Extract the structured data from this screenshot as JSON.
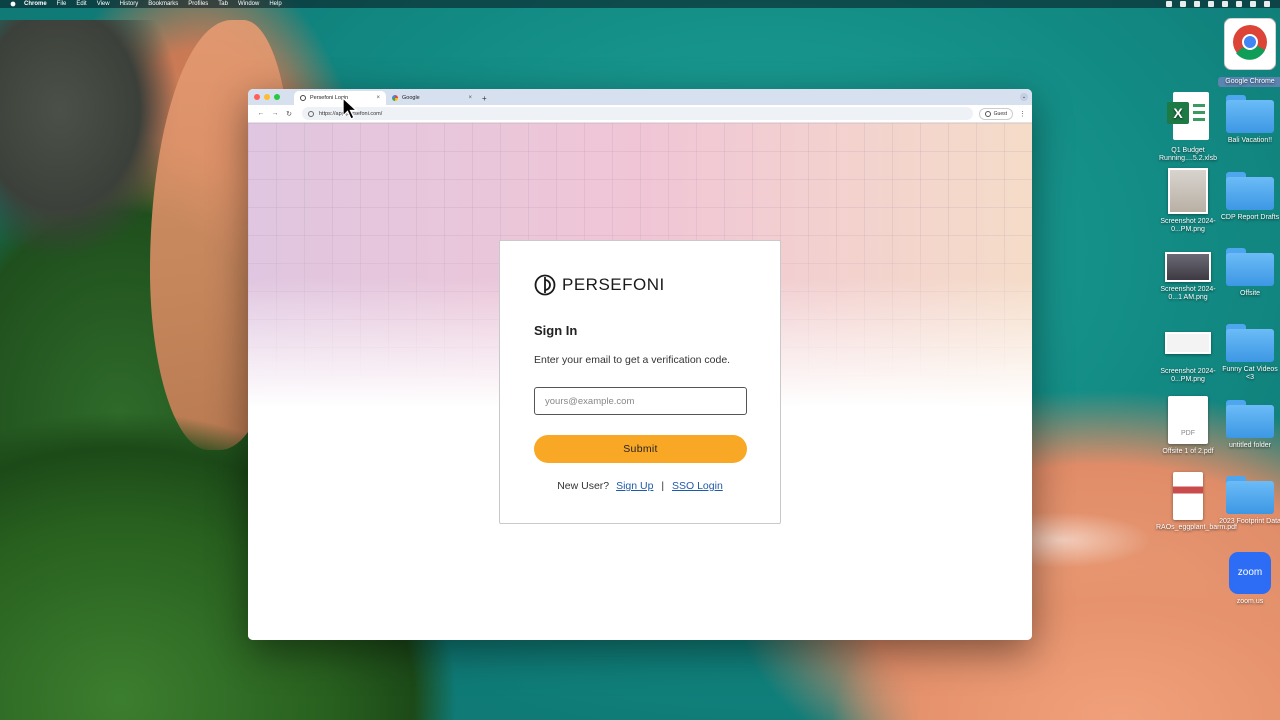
{
  "menubar": {
    "app": "Chrome",
    "items": [
      "File",
      "Edit",
      "View",
      "History",
      "Bookmarks",
      "Profiles",
      "Tab",
      "Window",
      "Help"
    ]
  },
  "desktop": {
    "icons": [
      {
        "label": "Google Chrome",
        "kind": "chrome-icon"
      },
      {
        "label": "Q1 Budget Running....5.2.xlsb",
        "kind": "excel-icon"
      },
      {
        "label": "Bali Vacation!!",
        "kind": "folder-icon"
      },
      {
        "label": "Screenshot 2024-0...PM.png",
        "kind": "image-icon"
      },
      {
        "label": "CDP Report Drafts",
        "kind": "folder-icon"
      },
      {
        "label": "Screenshot 2024-0...1 AM.png",
        "kind": "image-icon"
      },
      {
        "label": "Offsite",
        "kind": "folder-icon"
      },
      {
        "label": "Screenshot 2024-0...PM.png",
        "kind": "image-icon"
      },
      {
        "label": "Funny Cat Videos <3",
        "kind": "folder-icon"
      },
      {
        "label": "Offsite 1 of 2.pdf",
        "kind": "pdf-icon"
      },
      {
        "label": "untitled folder",
        "kind": "folder-icon"
      },
      {
        "label": "RAOs_eggplant_barm.pdf",
        "kind": "pdf-icon"
      },
      {
        "label": "2023 Footprint Data",
        "kind": "folder-icon"
      },
      {
        "label": "zoom.us",
        "kind": "zoom-icon"
      }
    ],
    "zoom_logo_text": "zoom",
    "pdf_badge": "PDF"
  },
  "browser": {
    "tabs": [
      {
        "label": "Persefoni Login",
        "active": true
      },
      {
        "label": "Google",
        "active": false
      }
    ],
    "url": "https://app.persefoni.com/",
    "profile_label": "Guest"
  },
  "login": {
    "brand": "PERSEFONI",
    "title": "Sign In",
    "description": "Enter your email to get a verification code.",
    "email_placeholder": "yours@example.com",
    "email_value": "",
    "submit_label": "Submit",
    "new_user_text": "New User?",
    "signup_label": "Sign Up",
    "separator": "|",
    "sso_label": "SSO Login"
  },
  "colors": {
    "submit_bg": "#f9a825",
    "link": "#1f5aa8"
  }
}
